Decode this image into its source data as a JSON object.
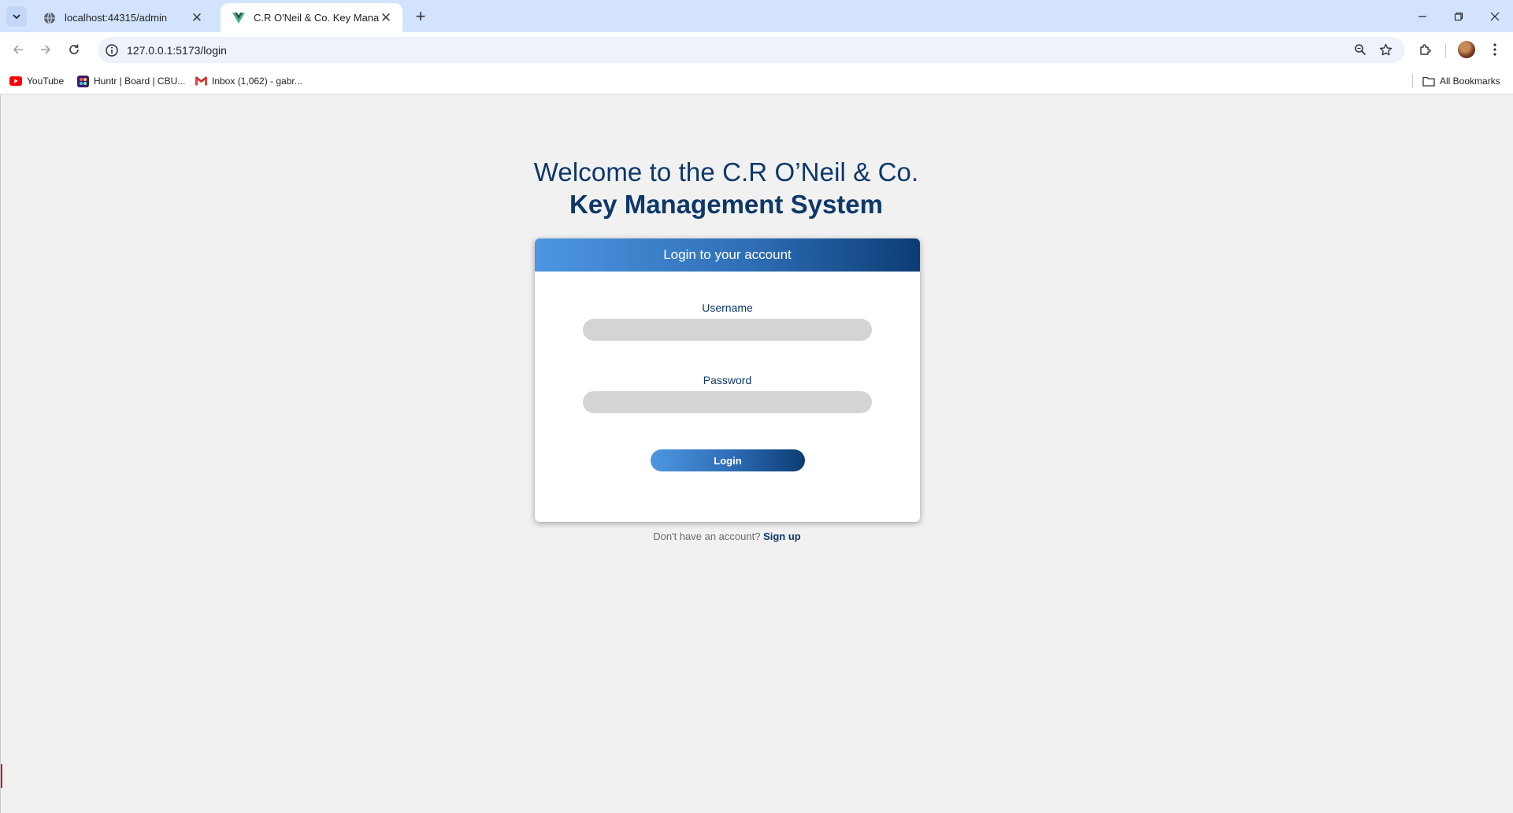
{
  "browser": {
    "tabs": [
      {
        "title": "localhost:44315/admin",
        "active": false,
        "favicon": "globe-icon"
      },
      {
        "title": "C.R O'Neil & Co. Key Managem",
        "active": true,
        "favicon": "vue-icon"
      }
    ],
    "address": "127.0.0.1:5173/login",
    "bookmarks": [
      {
        "label": "YouTube",
        "icon": "youtube-icon"
      },
      {
        "label": "Huntr | Board | CBU...",
        "icon": "huntr-icon"
      },
      {
        "label": "Inbox (1,062) - gabr...",
        "icon": "gmail-icon"
      }
    ],
    "all_bookmarks_label": "All Bookmarks"
  },
  "page": {
    "heading_line1": "Welcome to the C.R O’Neil & Co.",
    "heading_line2": "Key Management System",
    "card": {
      "title": "Login to your account",
      "username_label": "Username",
      "username_value": "",
      "password_label": "Password",
      "password_value": "",
      "login_button": "Login"
    },
    "signup_prompt": "Don't have an account?",
    "signup_link": "Sign up"
  },
  "colors": {
    "brand_dark": "#0d3868",
    "brand_light": "#4e96e1",
    "page_bg": "#f1f1f1",
    "field_bg": "#d4d4d4"
  }
}
